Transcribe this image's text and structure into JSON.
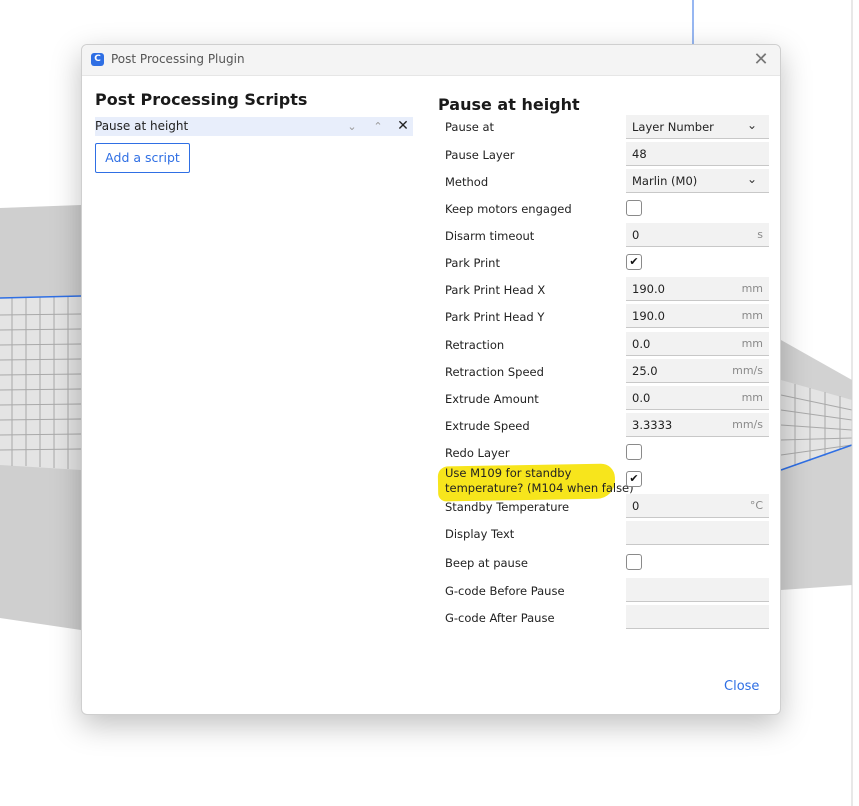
{
  "window": {
    "title": "Post Processing Plugin",
    "app_icon": "C"
  },
  "left": {
    "heading": "Post Processing Scripts",
    "scripts": [
      {
        "name": "Pause at height"
      }
    ],
    "add_label": "Add a script"
  },
  "right": {
    "heading": "Pause at height",
    "settings": {
      "pause_at": {
        "label": "Pause at",
        "value": "Layer Number"
      },
      "pause_layer": {
        "label": "Pause Layer",
        "value": "48"
      },
      "method": {
        "label": "Method",
        "value": "Marlin (M0)"
      },
      "keep_motors": {
        "label": "Keep motors engaged",
        "checked": false
      },
      "disarm_timeout": {
        "label": "Disarm timeout",
        "value": "0",
        "unit": "s"
      },
      "park_print": {
        "label": "Park Print",
        "checked": true
      },
      "park_x": {
        "label": "Park Print Head X",
        "value": "190.0",
        "unit": "mm"
      },
      "park_y": {
        "label": "Park Print Head Y",
        "value": "190.0",
        "unit": "mm"
      },
      "retraction": {
        "label": "Retraction",
        "value": "0.0",
        "unit": "mm"
      },
      "retraction_speed": {
        "label": "Retraction Speed",
        "value": "25.0",
        "unit": "mm/s"
      },
      "extrude_amount": {
        "label": "Extrude Amount",
        "value": "0.0",
        "unit": "mm"
      },
      "extrude_speed": {
        "label": "Extrude Speed",
        "value": "3.3333",
        "unit": "mm/s"
      },
      "redo_layer": {
        "label": "Redo Layer",
        "checked": false
      },
      "use_m109": {
        "label_line1": "Use M109 for standby",
        "label_line2": "temperature? (M104 when false)",
        "checked": true
      },
      "standby_temp": {
        "label": "Standby Temperature",
        "value": "0",
        "unit": "°C"
      },
      "display_text": {
        "label": "Display Text",
        "value": ""
      },
      "beep": {
        "label": "Beep at pause",
        "checked": false
      },
      "gcode_before": {
        "label": "G-code Before Pause",
        "value": ""
      },
      "gcode_after": {
        "label": "G-code After Pause",
        "value": ""
      }
    }
  },
  "footer": {
    "close_label": "Close"
  },
  "colors": {
    "accent": "#2f6fe4",
    "highlight": "#f7e51c",
    "selected_row": "#e8eefb",
    "field_bg": "#f2f2f2"
  },
  "icons": {
    "close": "close-icon",
    "chevron_down": "chevron-down-icon",
    "chevron_up": "chevron-up-icon",
    "check": "check-icon"
  }
}
